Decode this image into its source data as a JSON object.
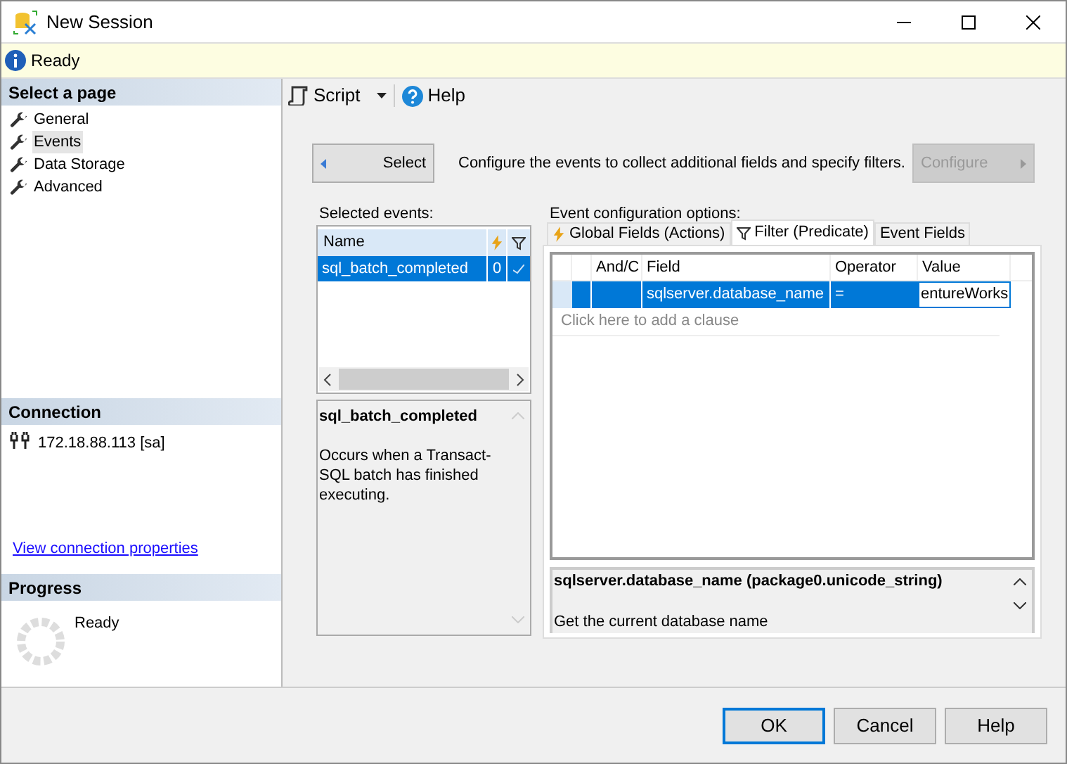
{
  "window": {
    "title": "New Session"
  },
  "status": {
    "text": "Ready"
  },
  "sidebar": {
    "header": "Select a page",
    "pages": [
      {
        "label": "General",
        "selected": false
      },
      {
        "label": "Events",
        "selected": true
      },
      {
        "label": "Data Storage",
        "selected": false
      },
      {
        "label": "Advanced",
        "selected": false
      }
    ]
  },
  "connection": {
    "header": "Connection",
    "server": "172.18.88.113 [sa]",
    "link": "View connection properties"
  },
  "progress": {
    "header": "Progress",
    "status": "Ready"
  },
  "toolbar": {
    "script": "Script",
    "help": "Help"
  },
  "select_button": {
    "label": "Select"
  },
  "instructions": "Configure the events to collect additional fields and specify filters.",
  "configure_button": {
    "label": "Configure",
    "disabled": true
  },
  "selected_events": {
    "label": "Selected events:",
    "column": "Name",
    "rows": [
      {
        "name": "sql_batch_completed",
        "actions": "0",
        "filtered": true,
        "selected": true
      }
    ]
  },
  "event_description": {
    "title": "sql_batch_completed",
    "text": "Occurs when a Transact-SQL batch has finished executing."
  },
  "config": {
    "label": "Event configuration options:",
    "tabs": [
      {
        "label": "Global Fields (Actions)",
        "kind": "actions",
        "selected": false
      },
      {
        "label": "Filter (Predicate)",
        "kind": "filter",
        "selected": true
      },
      {
        "label": "Event Fields",
        "kind": "plain",
        "selected": false
      }
    ],
    "columns": [
      "And/C",
      "Field",
      "Operator",
      "Value"
    ],
    "rows": [
      {
        "field": "sqlserver.database_name",
        "operator": "=",
        "value": "entureWorks",
        "selected": true
      }
    ],
    "add_clause": "Click here to add a clause",
    "field_info": {
      "title": "sqlserver.database_name (package0.unicode_string)",
      "text": "Get the current database name"
    }
  },
  "buttons": [
    {
      "label": "OK",
      "default": true
    },
    {
      "label": "Cancel",
      "default": false
    },
    {
      "label": "Help",
      "default": false
    }
  ]
}
